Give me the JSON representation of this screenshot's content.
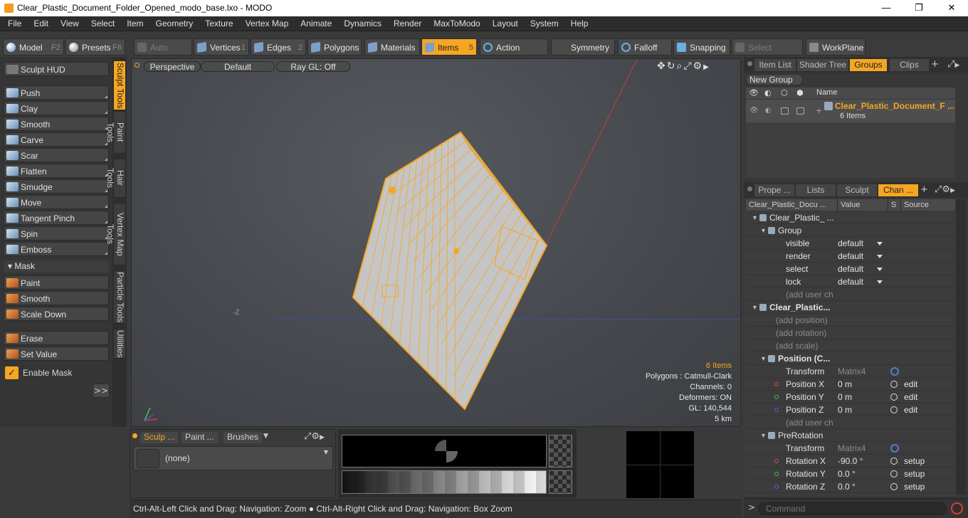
{
  "window": {
    "title": "Clear_Plastic_Document_Folder_Opened_modo_base.lxo - MODO",
    "minimize": "—",
    "maximize": "❐",
    "close": "✕"
  },
  "menu": [
    "File",
    "Edit",
    "View",
    "Select",
    "Item",
    "Geometry",
    "Texture",
    "Vertex Map",
    "Animate",
    "Dynamics",
    "Render",
    "MaxToModo",
    "Layout",
    "System",
    "Help"
  ],
  "toolbar": {
    "model": "Model",
    "model_key": "F2",
    "presets": "Presets",
    "presets_key": "F6",
    "auto_select": "Auto Select",
    "vertices": "Vertices",
    "vertices_key": "1",
    "edges": "Edges",
    "edges_key": "2",
    "polygons": "Polygons",
    "materials": "Materials",
    "items": "Items",
    "items_key": "5",
    "action_center": "Action Center",
    "symmetry": "Symmetry",
    "falloff": "Falloff",
    "snapping": "Snapping",
    "select_through": "Select Through",
    "workplane": "WorkPlane"
  },
  "left_panel": {
    "sculpt_hud": "Sculpt HUD",
    "tools": [
      "Push",
      "Clay",
      "Smooth",
      "Carve",
      "Scar",
      "Flatten",
      "Smudge",
      "Move",
      "Tangent Pinch",
      "Spin",
      "Emboss"
    ],
    "mask_header": "Mask",
    "mask_tools": [
      "Paint",
      "Smooth",
      "Scale Down"
    ],
    "erase": "Erase",
    "set_value": "Set Value",
    "enable_mask": "Enable Mask",
    "expand": ">>"
  },
  "vertical_tabs": [
    "Sculpt Tools",
    "Paint Tools",
    "Hair Tools",
    "Vertex Map Tools",
    "Particle Tools",
    "Utilities"
  ],
  "viewport": {
    "perspective": "Perspective",
    "default": "Default",
    "raygl": "Ray GL: Off",
    "axis_label": "-Z",
    "info": {
      "items": "6 Items",
      "polygons": "Polygons : Catmull-Clark",
      "channels": "Channels: 0",
      "deformers": "Deformers: ON",
      "gl": "GL: 140,544",
      "distance": "5 km"
    }
  },
  "sculpt_panel": {
    "tabs": [
      "Sculp ...",
      "Paint ...",
      "Brushes"
    ],
    "brush": "(none)"
  },
  "status": "Ctrl-Alt-Left Click and Drag: Navigation: Zoom ● Ctrl-Alt-Right Click and Drag: Navigation: Box Zoom",
  "groups_panel": {
    "tabs": [
      "Item List",
      "Shader Tree",
      "Groups",
      "Clips"
    ],
    "new_group": "New Group",
    "name_header": "Name",
    "group_name": "Clear_Plastic_Document_F ...",
    "group_count": "6 Items"
  },
  "channels_panel": {
    "tabs": [
      "Prope ...",
      "Lists",
      "Sculpt",
      "Chan ..."
    ],
    "headers": {
      "name": "Clear_Plastic_Docu ...",
      "value": "Value",
      "s": "S",
      "source": "Source"
    },
    "rows": [
      {
        "name": "Clear_Plastic_ ...",
        "value": "",
        "source": "",
        "indent": 1,
        "kind": "item"
      },
      {
        "name": "Group",
        "value": "",
        "source": "",
        "indent": 2,
        "kind": "sub"
      },
      {
        "name": "visible",
        "value": "default",
        "source": "",
        "indent": 3,
        "kind": "dd"
      },
      {
        "name": "render",
        "value": "default",
        "source": "",
        "indent": 3,
        "kind": "dd"
      },
      {
        "name": "select",
        "value": "default",
        "source": "",
        "indent": 3,
        "kind": "dd"
      },
      {
        "name": "lock",
        "value": "default",
        "source": "",
        "indent": 3,
        "kind": "dd"
      },
      {
        "name": "(add user ch ...",
        "value": "",
        "source": "",
        "indent": 3,
        "kind": "dim"
      },
      {
        "name": "Clear_Plastic...",
        "value": "",
        "source": "",
        "indent": 1,
        "kind": "hdr"
      },
      {
        "name": "(add position)",
        "value": "",
        "source": "",
        "indent": 2,
        "kind": "dim"
      },
      {
        "name": "(add rotation)",
        "value": "",
        "source": "",
        "indent": 2,
        "kind": "dim"
      },
      {
        "name": "(add scale)",
        "value": "",
        "source": "",
        "indent": 2,
        "kind": "dim"
      },
      {
        "name": "Position (C...",
        "value": "",
        "source": "",
        "indent": 2,
        "kind": "hdr"
      },
      {
        "name": "Transform",
        "value": "Matrix4",
        "source": "",
        "indent": 3,
        "kind": "mtx"
      },
      {
        "name": "Position X",
        "value": "0 m",
        "source": "edit",
        "indent": 3,
        "kind": "x"
      },
      {
        "name": "Position Y",
        "value": "0 m",
        "source": "edit",
        "indent": 3,
        "kind": "y"
      },
      {
        "name": "Position Z",
        "value": "0 m",
        "source": "edit",
        "indent": 3,
        "kind": "z"
      },
      {
        "name": "(add user ch ...",
        "value": "",
        "source": "",
        "indent": 3,
        "kind": "dim"
      },
      {
        "name": "PreRotation",
        "value": "",
        "source": "",
        "indent": 2,
        "kind": "sub"
      },
      {
        "name": "Transform",
        "value": "Matrix4",
        "source": "",
        "indent": 3,
        "kind": "mtx"
      },
      {
        "name": "Rotation X",
        "value": "-90.0 °",
        "source": "setup",
        "indent": 3,
        "kind": "x"
      },
      {
        "name": "Rotation Y",
        "value": "0.0 °",
        "source": "setup",
        "indent": 3,
        "kind": "y"
      },
      {
        "name": "Rotation Z",
        "value": "0.0 °",
        "source": "setup",
        "indent": 3,
        "kind": "z"
      }
    ]
  },
  "command": {
    "placeholder": "Command",
    "prompt": ">"
  },
  "colors": {
    "accent": "#f5a623",
    "panel": "#3a3a3a",
    "wire": "#f5a623"
  }
}
